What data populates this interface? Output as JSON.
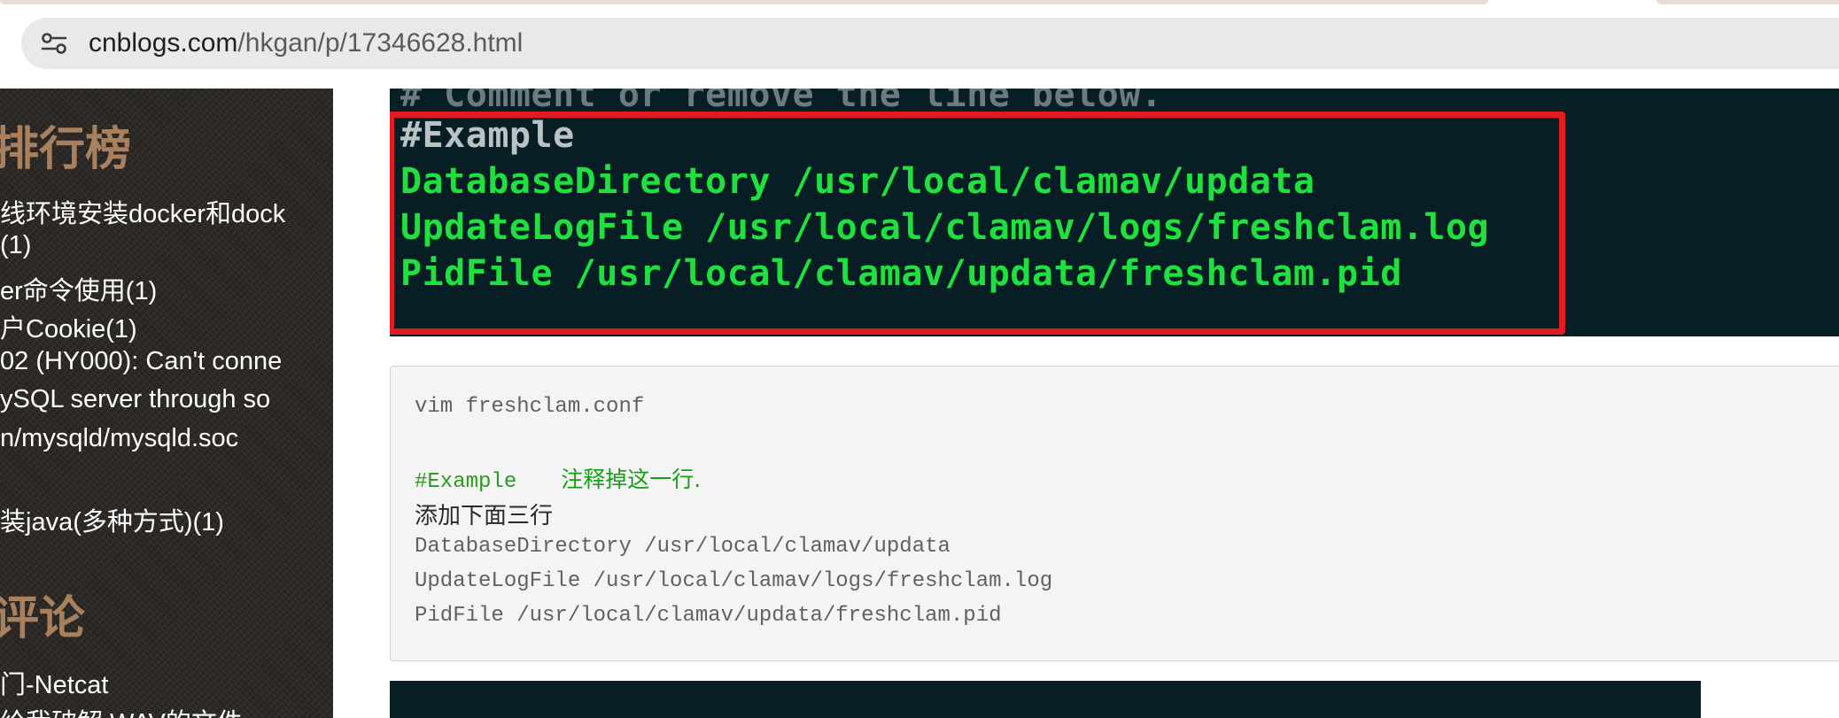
{
  "browser": {
    "url_host": "cnblogs.com",
    "url_path": "/hkgan/p/17346628.html",
    "site_info_icon": "tune-icon"
  },
  "sidebar": {
    "ranking_heading": "排行榜",
    "ranking_items": [
      "线环境安装docker和dock",
      "(1)",
      "er命令使用(1)",
      "户Cookie(1)",
      "02 (HY000): Can't conne",
      "ySQL server through so",
      "n/mysqld/mysqld.soc",
      "装java(多种方式)(1)"
    ],
    "comments_heading": "评论",
    "comment_items": [
      "门-Netcat",
      "给我破解.WAV的文件..."
    ]
  },
  "code_image": {
    "top_line": "# Comment or remove the line below.",
    "lines": [
      "#Example",
      "DatabaseDirectory /usr/local/clamav/updata",
      "UpdateLogFile /usr/local/clamav/logs/freshclam.log",
      "PidFile /usr/local/clamav/updata/freshclam.pid"
    ],
    "highlight_color": "#e51b23",
    "text_color": "#1fe03f"
  },
  "code_block": {
    "command": "vim freshclam.conf",
    "example": "#Example",
    "example_note": "注释掉这一行.",
    "add_note": "添加下面三行",
    "lines": [
      "DatabaseDirectory /usr/local/clamav/updata",
      "UpdateLogFile /usr/local/clamav/logs/freshclam.log",
      "PidFile /usr/local/clamav/updata/freshclam.pid"
    ]
  }
}
